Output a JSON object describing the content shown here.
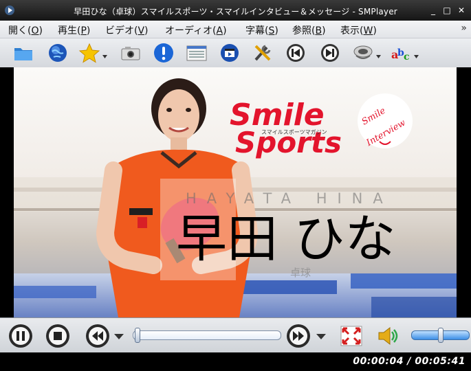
{
  "window": {
    "title": "早田ひな（卓球）スマイルスポーツ・スマイルインタビュー＆メッセージ - SMPlayer",
    "minimize": "_",
    "maximize": "□",
    "close": "✕"
  },
  "menu": {
    "items": [
      {
        "label": "開く(O)",
        "underline": "O"
      },
      {
        "label": "再生(P)",
        "underline": "P"
      },
      {
        "label": "ビデオ(V)",
        "underline": "V"
      },
      {
        "label": "オーディオ(A)",
        "underline": "A"
      },
      {
        "label": "字幕(S)",
        "underline": "S"
      },
      {
        "label": "参照(B)",
        "underline": "B"
      },
      {
        "label": "表示(W)",
        "underline": "W"
      }
    ],
    "more": "»"
  },
  "toolbar": {
    "icons": [
      "folder-icon",
      "globe-icon",
      "star-icon",
      "camera-icon",
      "info-icon",
      "playlist-icon",
      "media-info-icon",
      "settings-icon",
      "previous-icon",
      "next-icon",
      "audio-icon",
      "subtitle-icon"
    ]
  },
  "video": {
    "logo_line1": "Smile",
    "logo_line2": "Sports",
    "logo_subtitle": "スマイルスポーツマガジン",
    "badge_line1": "Smile",
    "badge_line2": "Interview",
    "romaji_name": "HAYATA HINA",
    "name": "早田 ひな",
    "sport": "卓球",
    "jersey_sponsor1": "LUMICA",
    "jersey_sponsor2": "Nittaku",
    "colors": {
      "jersey": "#f05a1e",
      "logo_red": "#e3142c"
    }
  },
  "controls": {
    "seek_fraction": 0.012,
    "volume_fraction": 0.5
  },
  "status": {
    "time": "00:00:04 / 00:05:41"
  }
}
